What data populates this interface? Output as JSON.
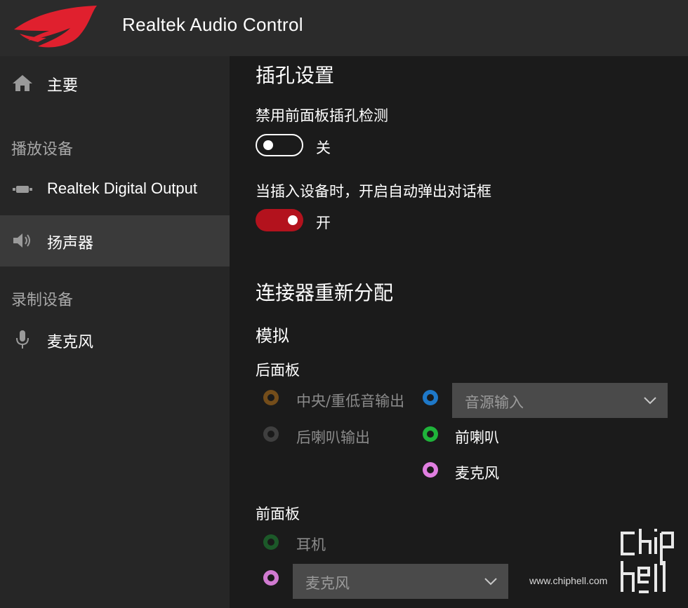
{
  "window": {
    "title": "Realtek Audio Control"
  },
  "sidebar": {
    "home": {
      "label": "主要",
      "icon": "home-icon"
    },
    "playback_section": "播放设备",
    "playback_items": [
      {
        "label": "Realtek Digital Output",
        "icon": "digital-output-icon",
        "active": false
      },
      {
        "label": "扬声器",
        "icon": "speaker-icon",
        "active": true
      }
    ],
    "record_section": "录制设备",
    "record_items": [
      {
        "label": "麦克风",
        "icon": "microphone-icon",
        "active": false
      }
    ]
  },
  "main": {
    "jack_settings_title": "插孔设置",
    "disable_front_detect": {
      "label": "禁用前面板插孔检测",
      "state": "关",
      "on": false
    },
    "auto_popup": {
      "label": "当插入设备时，开启自动弹出对话框",
      "state": "开",
      "on": true
    },
    "reassign_title": "连接器重新分配",
    "analog_label": "模拟",
    "rear_panel": {
      "label": "后面板",
      "ports": [
        {
          "label": "中央/重低音输出",
          "color": "#e08a1a",
          "enabled": false
        },
        {
          "label": "后喇叭输出",
          "color": "#6b6b6b",
          "enabled": false
        },
        {
          "label": "音源输入",
          "color": "#1e78c8",
          "enabled": true,
          "type": "select"
        },
        {
          "label": "前喇叭",
          "color": "#1fb33a",
          "enabled": true
        },
        {
          "label": "麦克风",
          "color": "#e07ee0",
          "enabled": true
        }
      ]
    },
    "front_panel": {
      "label": "前面板",
      "ports": [
        {
          "label": "耳机",
          "color": "#1fa53a",
          "enabled": false
        },
        {
          "label": "麦克风",
          "color": "#d07ad0",
          "enabled": true,
          "type": "select"
        }
      ]
    }
  },
  "watermark": {
    "url": "www.chiphell.com"
  },
  "colors": {
    "accent": "#b3121d",
    "sidebar_bg": "#262626",
    "titlebar_bg": "#2b2b2b",
    "main_bg": "#1b1b1b"
  }
}
